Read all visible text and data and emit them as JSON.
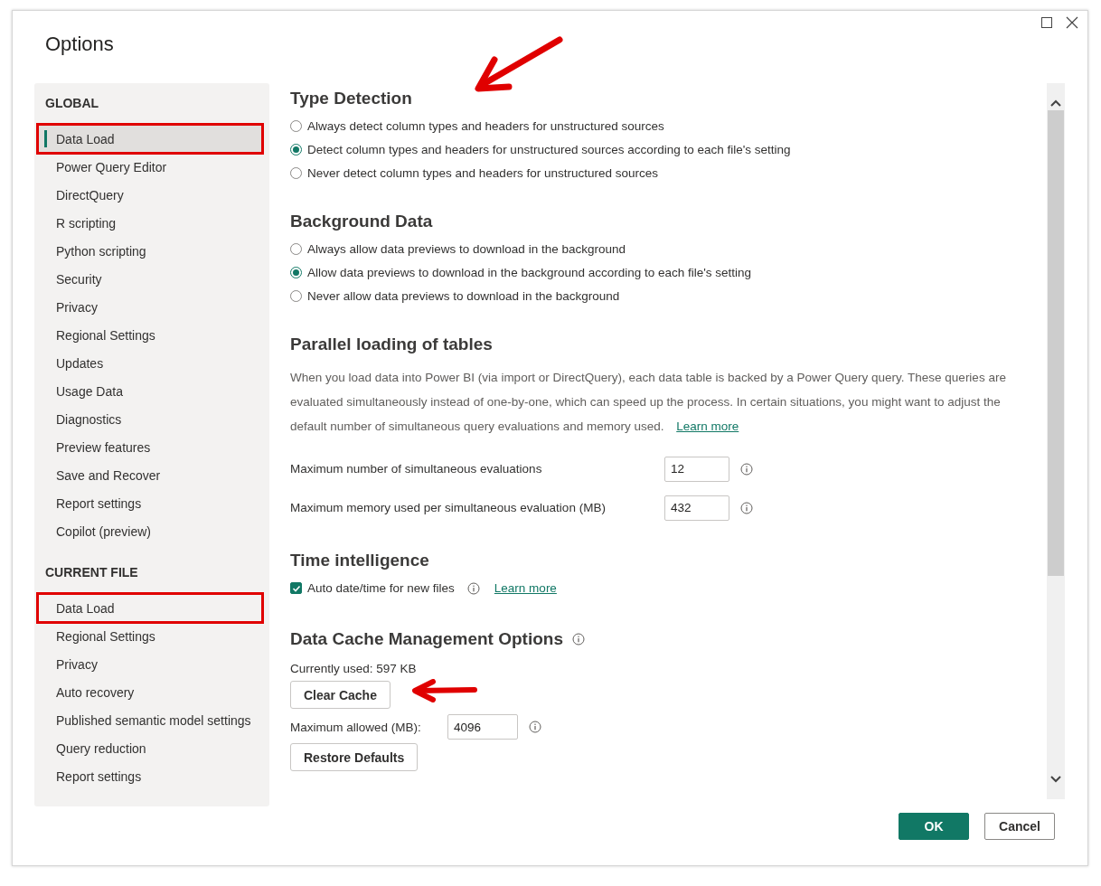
{
  "window": {
    "title": "Options"
  },
  "sidebar": {
    "groups": [
      {
        "heading": "GLOBAL",
        "items": [
          {
            "label": "Data Load",
            "selected": true,
            "highlighted": true
          },
          {
            "label": "Power Query Editor",
            "selected": false,
            "highlighted": false
          },
          {
            "label": "DirectQuery",
            "selected": false,
            "highlighted": false
          },
          {
            "label": "R scripting",
            "selected": false,
            "highlighted": false
          },
          {
            "label": "Python scripting",
            "selected": false,
            "highlighted": false
          },
          {
            "label": "Security",
            "selected": false,
            "highlighted": false
          },
          {
            "label": "Privacy",
            "selected": false,
            "highlighted": false
          },
          {
            "label": "Regional Settings",
            "selected": false,
            "highlighted": false
          },
          {
            "label": "Updates",
            "selected": false,
            "highlighted": false
          },
          {
            "label": "Usage Data",
            "selected": false,
            "highlighted": false
          },
          {
            "label": "Diagnostics",
            "selected": false,
            "highlighted": false
          },
          {
            "label": "Preview features",
            "selected": false,
            "highlighted": false
          },
          {
            "label": "Save and Recover",
            "selected": false,
            "highlighted": false
          },
          {
            "label": "Report settings",
            "selected": false,
            "highlighted": false
          },
          {
            "label": "Copilot (preview)",
            "selected": false,
            "highlighted": false
          }
        ]
      },
      {
        "heading": "CURRENT FILE",
        "items": [
          {
            "label": "Data Load",
            "selected": false,
            "highlighted": true
          },
          {
            "label": "Regional Settings",
            "selected": false,
            "highlighted": false
          },
          {
            "label": "Privacy",
            "selected": false,
            "highlighted": false
          },
          {
            "label": "Auto recovery",
            "selected": false,
            "highlighted": false
          },
          {
            "label": "Published semantic model settings",
            "selected": false,
            "highlighted": false
          },
          {
            "label": "Query reduction",
            "selected": false,
            "highlighted": false
          },
          {
            "label": "Report settings",
            "selected": false,
            "highlighted": false
          }
        ]
      }
    ]
  },
  "sections": [
    {
      "kind": "radios",
      "heading": "Type Detection",
      "arrow": true,
      "options": [
        {
          "label": "Always detect column types and headers for unstructured sources",
          "selected": false
        },
        {
          "label": "Detect column types and headers for unstructured sources according to each file's setting",
          "selected": true
        },
        {
          "label": "Never detect column types and headers for unstructured sources",
          "selected": false
        }
      ]
    },
    {
      "kind": "radios",
      "heading": "Background Data",
      "arrow": false,
      "options": [
        {
          "label": "Always allow data previews to download in the background",
          "selected": false
        },
        {
          "label": "Allow data previews to download in the background according to each file's setting",
          "selected": true
        },
        {
          "label": "Never allow data previews to download in the background",
          "selected": false
        }
      ]
    },
    {
      "kind": "fields",
      "heading": "Parallel loading of tables",
      "description": "When you load data into Power BI (via import or DirectQuery), each data table is backed by a Power Query query. These queries are evaluated simultaneously instead of one-by-one, which can speed up the process. In certain situations, you might want to adjust the default number of simultaneous query evaluations and memory used.",
      "link": "Learn more",
      "fields": [
        {
          "label": "Maximum number of simultaneous evaluations",
          "value": "12"
        },
        {
          "label": "Maximum memory used per simultaneous evaluation (MB)",
          "value": "432"
        }
      ]
    },
    {
      "kind": "checkbox",
      "heading": "Time intelligence",
      "checkbox": {
        "label": "Auto date/time for new files",
        "checked": true
      },
      "link": "Learn more"
    },
    {
      "kind": "cache",
      "heading": "Data Cache Management Options",
      "usage": "Currently used: 597 KB",
      "clear_button": {
        "label": "Clear Cache",
        "arrow": true
      },
      "max_label": "Maximum allowed (MB):",
      "max_value": "4096",
      "restore_button": "Restore Defaults"
    }
  ],
  "footer": {
    "buttons": [
      {
        "label": "OK",
        "kind": "primary"
      },
      {
        "label": "Cancel",
        "kind": "secondary"
      }
    ]
  }
}
